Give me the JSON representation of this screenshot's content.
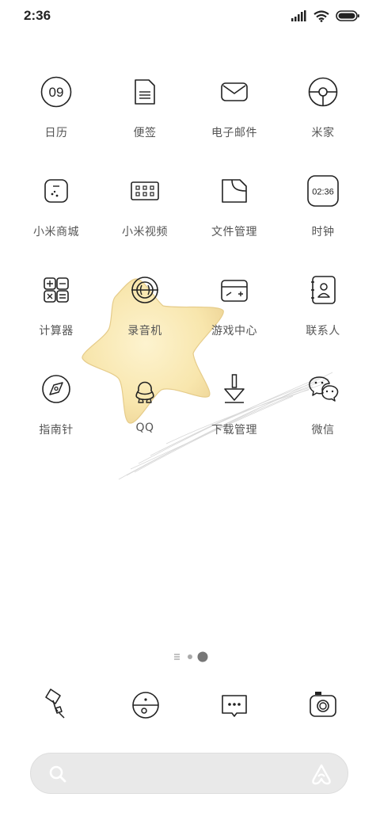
{
  "status": {
    "time": "2:36",
    "icons": [
      "signal-icon",
      "wifi-icon",
      "battery-icon"
    ]
  },
  "apps": [
    {
      "name": "日历",
      "icon": "calendar-icon",
      "icon_text": "09"
    },
    {
      "name": "便签",
      "icon": "notes-icon"
    },
    {
      "name": "电子邮件",
      "icon": "mail-icon"
    },
    {
      "name": "米家",
      "icon": "mi-home-icon"
    },
    {
      "name": "小米商城",
      "icon": "mi-store-icon"
    },
    {
      "name": "小米视频",
      "icon": "mi-video-icon"
    },
    {
      "name": "文件管理",
      "icon": "file-manager-icon"
    },
    {
      "name": "时钟",
      "icon": "clock-icon",
      "icon_text": "02:36"
    },
    {
      "name": "计算器",
      "icon": "calculator-icon"
    },
    {
      "name": "录音机",
      "icon": "recorder-icon"
    },
    {
      "name": "游戏中心",
      "icon": "game-center-icon"
    },
    {
      "name": "联系人",
      "icon": "contacts-icon"
    },
    {
      "name": "指南针",
      "icon": "compass-icon"
    },
    {
      "name": "QQ",
      "icon": "qq-icon"
    },
    {
      "name": "下载管理",
      "icon": "download-manager-icon"
    },
    {
      "name": "微信",
      "icon": "wechat-icon"
    }
  ],
  "page_indicator": {
    "pages": 2,
    "current": 2
  },
  "dock": [
    {
      "icon": "phone-icon"
    },
    {
      "icon": "browser-icon"
    },
    {
      "icon": "messages-icon"
    },
    {
      "icon": "camera-icon"
    }
  ],
  "search": {
    "icon": "search-icon",
    "assistant_icon": "assistant-icon"
  }
}
